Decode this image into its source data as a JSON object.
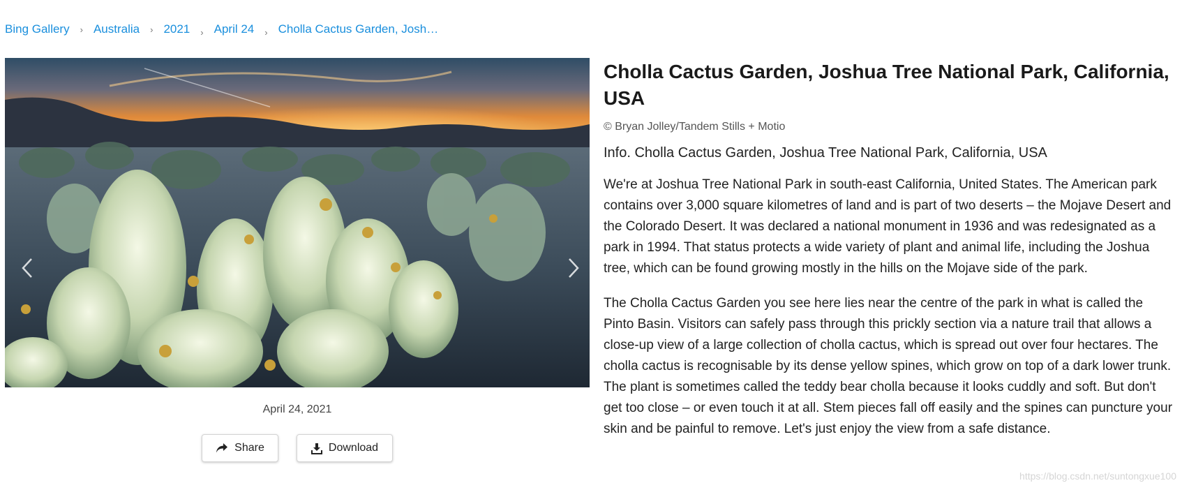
{
  "breadcrumb": [
    {
      "label": "Bing Gallery"
    },
    {
      "label": "Australia"
    },
    {
      "label": "2021"
    },
    {
      "label": "April 24"
    },
    {
      "label": "Cholla Cactus Garden, Josh…"
    }
  ],
  "photo": {
    "alt": "Cholla Cactus Garden, Joshua Tree National Park, California, USA",
    "date": "April 24, 2021",
    "prev_icon": "chevron-left-icon",
    "next_icon": "chevron-right-icon"
  },
  "actions": {
    "share_label": "Share",
    "share_icon": "share-arrow-icon",
    "download_label": "Download",
    "download_icon": "download-icon"
  },
  "detail": {
    "title": "Cholla Cactus Garden, Joshua Tree National Park, California, USA",
    "credit": "© Bryan Jolley/Tandem Stills + Motio",
    "info": "Info. Cholla Cactus Garden, Joshua Tree National Park, California, USA",
    "paragraphs": [
      "We're at Joshua Tree National Park in south-east California, United States. The American park contains over 3,000 square kilometres of land and is part of two deserts – the Mojave Desert and the Colorado Desert. It was declared a national monument in 1936 and was redesignated as a park in 1994. That status protects a wide variety of plant and animal life, including the Joshua tree, which can be found growing mostly in the hills on the Mojave side of the park.",
      "The Cholla Cactus Garden you see here lies near the centre of the park in what is called the Pinto Basin. Visitors can safely pass through this prickly section via a nature trail that allows a close-up view of a large collection of cholla cactus, which is spread out over four hectares. The cholla cactus is recognisable by its dense yellow spines, which grow on top of a dark lower trunk. The plant is sometimes called the teddy bear cholla because it looks cuddly and soft. But don't get too close – or even touch it at all. Stem pieces fall off easily and the spines can puncture your skin and be painful to remove. Let's just enjoy the view from a safe distance."
    ]
  },
  "watermark": "https://blog.csdn.net/suntongxue100",
  "colors": {
    "link": "#1a8fdd",
    "text": "#222222",
    "muted": "#555555",
    "sky_orange": "#f0a040",
    "cactus_green": "#c8d8a8"
  }
}
